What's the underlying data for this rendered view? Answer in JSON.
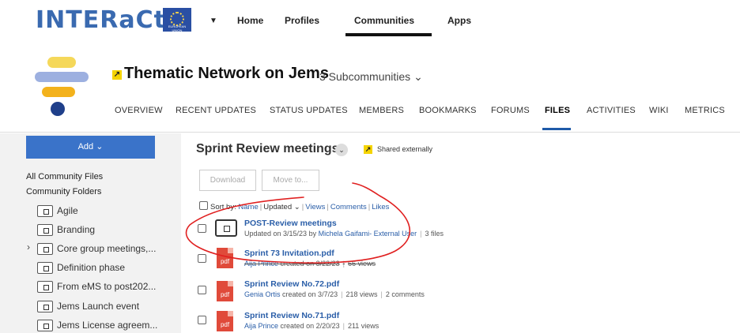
{
  "brand": {
    "logo_text": "INTERaCt",
    "flag_caption": "EUROPEAN UNION"
  },
  "nav": {
    "caret": "▼",
    "items": [
      "Home",
      "Profiles",
      "Communities",
      "Apps"
    ],
    "active": "Communities"
  },
  "community": {
    "external_mark": "↗",
    "title": "Thematic Network on Jems",
    "subcommunities": "3 Subcommunities",
    "subcommunities_caret": "⌄",
    "tabs": [
      "OVERVIEW",
      "RECENT UPDATES",
      "STATUS UPDATES",
      "MEMBERS",
      "BOOKMARKS",
      "FORUMS",
      "FILES",
      "ACTIVITIES",
      "WIKI",
      "METRICS"
    ],
    "active_tab": "FILES"
  },
  "sidebar": {
    "add_label": "Add ⌄",
    "links": [
      "All Community Files",
      "Community Folders"
    ],
    "expand_icon": "›",
    "folders": [
      "Agile",
      "Branding",
      "Core group meetings,...",
      "Definition phase",
      "From eMS to post202...",
      "Jems Launch event",
      "Jems License agreem..."
    ]
  },
  "main": {
    "title": "Sprint Review meetings",
    "title_drop": "⌄",
    "shared_label": "Shared externally",
    "buttons": {
      "download": "Download",
      "move": "Move to..."
    },
    "sort": {
      "label": "Sort by:",
      "name": "Name",
      "updated": "Updated ⌄",
      "views": "Views",
      "comments": "Comments",
      "likes": "Likes"
    },
    "files": [
      {
        "name": "POST-Review meetings",
        "meta_prefix": "Updated on 3/15/23 by",
        "who": "Michela Gaifami- External User",
        "extra": "3 files",
        "type": "folder"
      },
      {
        "name": "Sprint 73 Invitation.pdf",
        "who": "Aija Prince",
        "meta_prefix": "created on 3/22/23",
        "extra": "66 views",
        "type": "pdf"
      },
      {
        "name": "Sprint Review No.72.pdf",
        "who": "Genia Ortis",
        "meta_prefix": "created on 3/7/23",
        "extra": "218 views",
        "extra2": "2 comments",
        "type": "pdf"
      },
      {
        "name": "Sprint Review No.71.pdf",
        "who": "Aija Prince",
        "meta_prefix": "created on 2/20/23",
        "extra": "211 views",
        "type": "pdf"
      }
    ],
    "pdf_label": "pdf"
  },
  "colors": {
    "accent": "#3a73c9",
    "link": "#2a5ea8",
    "annotation": "#e02020",
    "pdf": "#e04a3a",
    "external": "#f5d400"
  }
}
